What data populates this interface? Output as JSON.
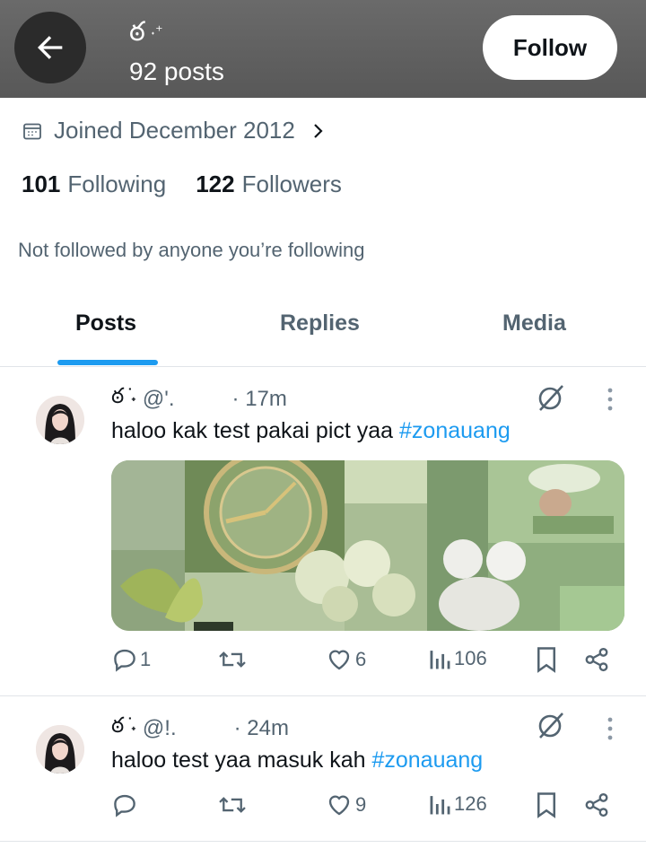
{
  "header": {
    "name": "ఠ",
    "name_suffix": "˖⁺",
    "posts_count": "92 posts",
    "follow_label": "Follow"
  },
  "profile": {
    "joined": "Joined December 2012",
    "following_count": "101",
    "following_label": "Following",
    "followers_count": "122",
    "followers_label": "Followers",
    "not_followed_text": "Not followed by anyone you’re following"
  },
  "tabs": [
    {
      "label": "Posts",
      "active": true
    },
    {
      "label": "Replies",
      "active": false
    },
    {
      "label": "Media",
      "active": false
    }
  ],
  "posts": [
    {
      "display_name": "ఠ ̇˖",
      "handle": "@'.",
      "time": "· 17m",
      "text": "haloo kak test pakai pict yaa ",
      "hashtag": "#zonauang",
      "has_media": true,
      "replies": "1",
      "reposts": "",
      "likes": "6",
      "views": "106"
    },
    {
      "display_name": "ఠ ̇˖",
      "handle": "@!.",
      "time": "· 24m",
      "text": "haloo test yaa masuk kah ",
      "hashtag": "#zonauang",
      "has_media": false,
      "replies": "",
      "reposts": "",
      "likes": "9",
      "views": "126"
    }
  ],
  "colors": {
    "accent": "#1d9bf0",
    "secondary_text": "#536471",
    "primary_text": "#0f1419",
    "header_bg": "#5f5f5f"
  }
}
